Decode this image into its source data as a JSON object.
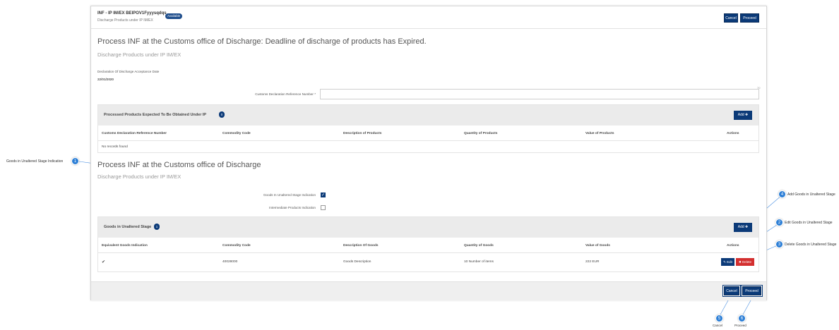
{
  "header": {
    "title": "INF - IP IM/EX BEIPOV1Fyyysqdqs",
    "badge": "Available",
    "subtitle": "Discharge Products under IP IM/EX",
    "cancel_label": "Cancel",
    "proceed_label": "Proceed"
  },
  "section1": {
    "heading": "Process INF at the Customs office of Discharge: Deadline of discharge of products has Expired.",
    "subheading": "Discharge Products under IP IM/EX",
    "acceptance_date_label": "Declaration Of Discharge Acceptance Date",
    "acceptance_date_value": "22/01/2020",
    "ref_number_label": "Customs Declaration Reference Number *",
    "ref_number_value": "",
    "ref_counter": "70"
  },
  "processed_products": {
    "title": "Processed Products Expected To Be Obtained Under IP",
    "count": "0",
    "add_label": "Add",
    "columns": [
      "Customs Declaration Reference Number",
      "Commodity Code",
      "Description of Products",
      "Quantity of Products",
      "Value of Products",
      "Actions"
    ],
    "empty_text": "No records found"
  },
  "section2": {
    "heading": "Process INF at the Customs office of Discharge",
    "subheading": "Discharge Products under IP IM/EX",
    "goods_unaltered_label": "Goods In Unaltered Stage Indication",
    "goods_unaltered_checked": true,
    "intermediate_label": "Intermediate Products Indication",
    "intermediate_checked": false
  },
  "goods_unaltered": {
    "title": "Goods in Unaltered Stage",
    "count": "1",
    "add_label": "Add",
    "columns": [
      "Equivalent Goods Indication",
      "Commodity Code",
      "Description Of Goods",
      "Quantity of Goods",
      "Value of Goods",
      "Actions"
    ],
    "rows": [
      {
        "equivalent": "✔",
        "commodity": "40028000",
        "description": "Goods Description",
        "quantity": "10 Number of items",
        "value": "222 EUR"
      }
    ],
    "edit_label": "Edit",
    "delete_label": "Delete"
  },
  "footer": {
    "cancel_label": "Cancel",
    "proceed_label": "Proceed"
  },
  "callouts": {
    "c1": {
      "num": "1",
      "text": "Goods in Unaltered Stage Indication"
    },
    "c2": {
      "num": "2",
      "text": "Edit Goods in Unaltered Stage"
    },
    "c3": {
      "num": "3",
      "text": "Delete Goods in Unaltered Stage"
    },
    "c4": {
      "num": "4",
      "text": "Add Goods in Unaltered Stage"
    },
    "c5": {
      "num": "5",
      "text": "Cancel"
    },
    "c6": {
      "num": "6",
      "text": "Proceed"
    }
  },
  "colors": {
    "primary": "#0b3a78",
    "danger": "#d32f2f",
    "marker": "#2d7fd6"
  }
}
